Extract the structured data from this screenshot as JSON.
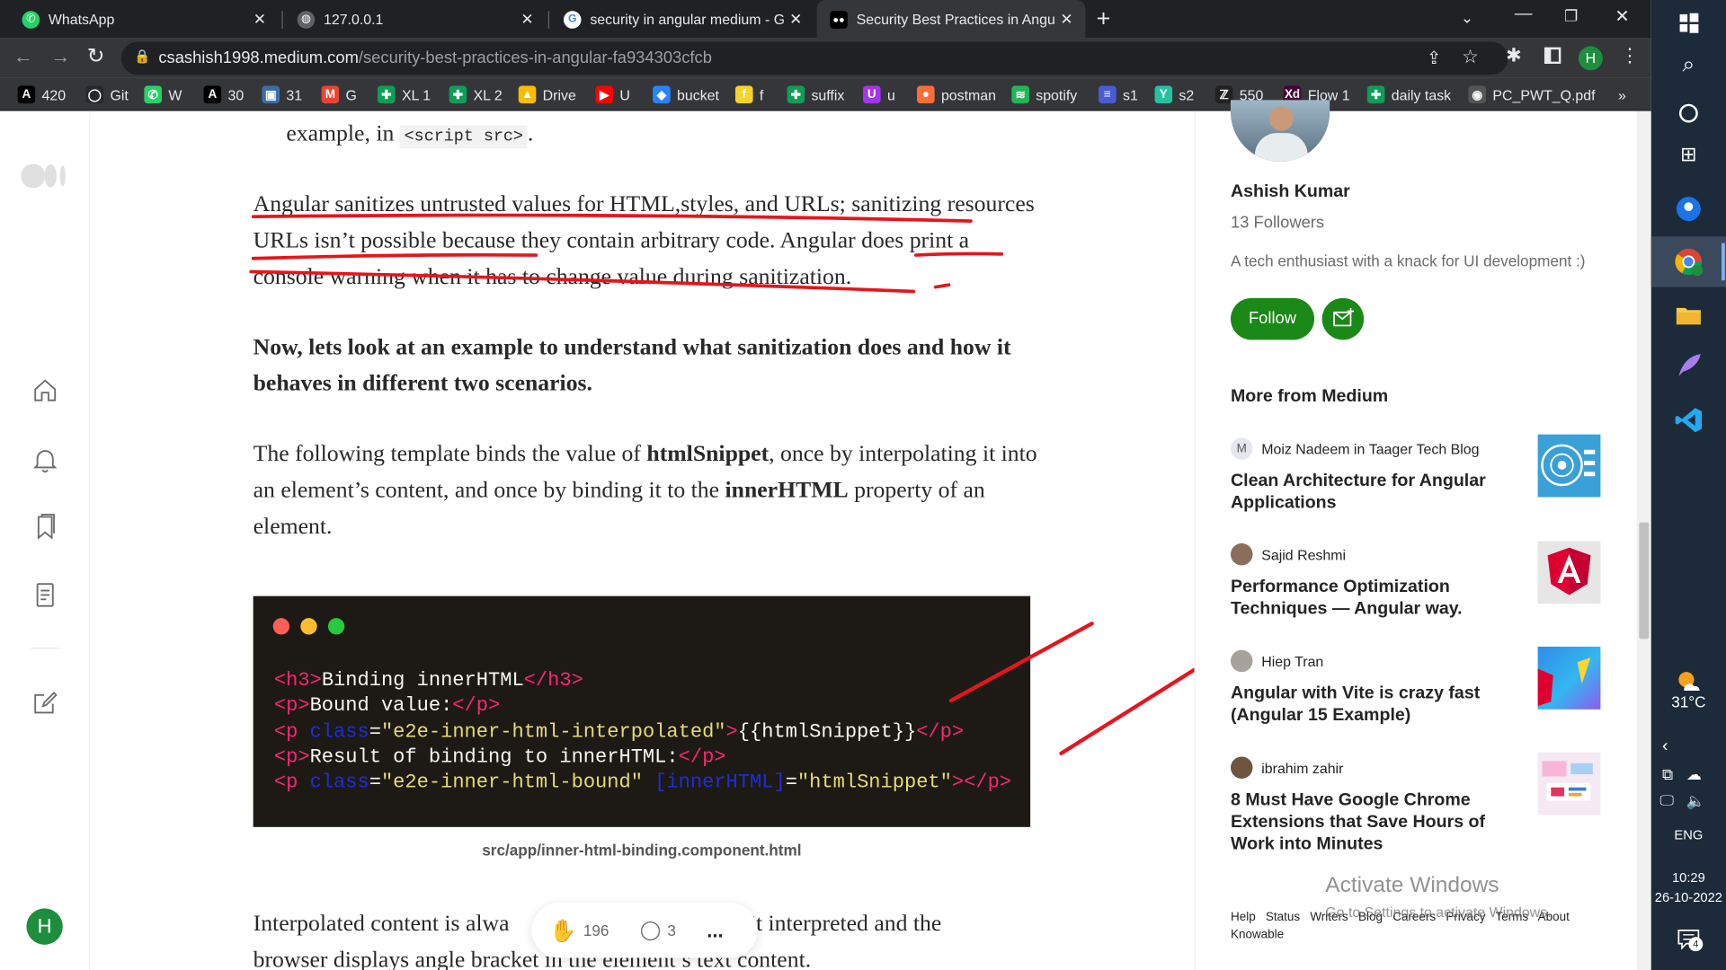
{
  "browser": {
    "tabs": [
      {
        "title": "WhatsApp",
        "icon": "whatsapp-icon"
      },
      {
        "title": "127.0.0.1",
        "icon": "globe-icon"
      },
      {
        "title": "security in angular medium - Goo",
        "icon": "google-icon"
      },
      {
        "title": "Security Best Practices in Angular",
        "icon": "medium-icon"
      }
    ],
    "url_host": "csashish1998.medium.com",
    "url_path": "/security-best-practices-in-angular-fa934303cfcb",
    "profile_initial": "H",
    "bookmarks": [
      {
        "label": "420",
        "icon": "a-icon",
        "color": "#000000",
        "glyph": "A"
      },
      {
        "label": "Git",
        "icon": "github-icon",
        "color": "#24292e",
        "glyph": "◯"
      },
      {
        "label": "W",
        "icon": "whatsapp-icon",
        "color": "#25d366",
        "glyph": "✆"
      },
      {
        "label": "30",
        "icon": "a-icon",
        "color": "#000000",
        "glyph": "A"
      },
      {
        "label": "31",
        "icon": "site-icon",
        "color": "#3b6ea8",
        "glyph": "▣"
      },
      {
        "label": "G",
        "icon": "gmail-icon",
        "color": "#ea4335",
        "glyph": "M"
      },
      {
        "label": "XL 1",
        "icon": "sheets-icon",
        "color": "#0f9d58",
        "glyph": "✚"
      },
      {
        "label": "XL 2",
        "icon": "sheets-icon",
        "color": "#0f9d58",
        "glyph": "✚"
      },
      {
        "label": "Drive",
        "icon": "drive-icon",
        "color": "#fbbc04",
        "glyph": "▲"
      },
      {
        "label": "U",
        "icon": "youtube-icon",
        "color": "#ff0000",
        "glyph": "▶"
      },
      {
        "label": "bucket",
        "icon": "bucket-icon",
        "color": "#2684ff",
        "glyph": "◆"
      },
      {
        "label": "f",
        "icon": "flipkart-icon",
        "color": "#f7d22b",
        "glyph": "f"
      },
      {
        "label": "suffix",
        "icon": "sheets-icon",
        "color": "#0f9d58",
        "glyph": "✚"
      },
      {
        "label": "u",
        "icon": "udemy-icon",
        "color": "#a435f0",
        "glyph": "U"
      },
      {
        "label": "postman",
        "icon": "postman-icon",
        "color": "#ff6c37",
        "glyph": "●"
      },
      {
        "label": "spotify",
        "icon": "spotify-icon",
        "color": "#1db954",
        "glyph": "≋"
      },
      {
        "label": "s1",
        "icon": "site-icon",
        "color": "#4a5bd4",
        "glyph": "≡"
      },
      {
        "label": "s2",
        "icon": "site-icon",
        "color": "#25c2a0",
        "glyph": "Y"
      },
      {
        "label": "550",
        "icon": "site-icon",
        "color": "#222222",
        "glyph": "ℤ"
      },
      {
        "label": "Flow 1",
        "icon": "xd-icon",
        "color": "#470137",
        "glyph": "Xd"
      },
      {
        "label": "daily task",
        "icon": "sheets-icon",
        "color": "#0f9d58",
        "glyph": "✚"
      },
      {
        "label": "PC_PWT_Q.pdf",
        "icon": "chrome-icon",
        "color": "#555555",
        "glyph": "◉"
      }
    ]
  },
  "article": {
    "top_fragment_prefix": "example, in ",
    "top_fragment_code": "<script src>",
    "top_fragment_suffix": ".",
    "para1": "Angular sanitizes untrusted values for HTML,styles, and URLs; sanitizing resources URLs isn’t possible because they contain arbitrary code. Angular does print a console warning when it has to change value during sanitization.",
    "para2": "Now, lets look at an example to understand what sanitization does and how it behaves in different two scenarios.",
    "para3_a": "The following template binds the value of ",
    "para3_b": "htmlSnippet",
    "para3_c": ", once by interpolating it into an element’s content, and once by binding it to the ",
    "para3_d": "innerHTML",
    "para3_e": " property of an element.",
    "code_lines": [
      [
        {
          "t": "<h3>",
          "c": "#f92672"
        },
        {
          "t": "Binding innerHTML",
          "c": "#f8f8f2"
        },
        {
          "t": "</h3>",
          "c": "#f92672"
        }
      ],
      [
        {
          "t": "<p>",
          "c": "#f92672"
        },
        {
          "t": "Bound value:",
          "c": "#f8f8f2"
        },
        {
          "t": "</p>",
          "c": "#f92672"
        }
      ],
      [
        {
          "t": "<p ",
          "c": "#f92672"
        },
        {
          "t": "class",
          "c": "#1e2ed6"
        },
        {
          "t": "=",
          "c": "#f8f8f2"
        },
        {
          "t": "\"e2e-inner-html-interpolated\"",
          "c": "#e6db74"
        },
        {
          "t": ">",
          "c": "#f92672"
        },
        {
          "t": "{{htmlSnippet}}",
          "c": "#f8f8f2"
        },
        {
          "t": "</p>",
          "c": "#f92672"
        }
      ],
      [
        {
          "t": "<p>",
          "c": "#f92672"
        },
        {
          "t": "Result of binding to innerHTML:",
          "c": "#f8f8f2"
        },
        {
          "t": "</p>",
          "c": "#f92672"
        }
      ],
      [
        {
          "t": "<p ",
          "c": "#f92672"
        },
        {
          "t": "class",
          "c": "#1e2ed6"
        },
        {
          "t": "=",
          "c": "#f8f8f2"
        },
        {
          "t": "\"e2e-inner-html-bound\" ",
          "c": "#e6db74"
        },
        {
          "t": "[innerHTML]",
          "c": "#1e2ed6"
        },
        {
          "t": "=",
          "c": "#f8f8f2"
        },
        {
          "t": "\"htmlSnippet\"",
          "c": "#e6db74"
        },
        {
          "t": "></p>",
          "c": "#f92672"
        }
      ]
    ],
    "caption": "src/app/inner-html-binding.component.html",
    "bottom_line1_a": "Interpolated content is alwa",
    "bottom_line1_b": "n’t interpreted and the",
    "bottom_line2": "browser displays angle bracket in the element’s text content.",
    "claps": "196",
    "responses": "3",
    "more": "..."
  },
  "author": {
    "name": "Ashish Kumar",
    "followers": "13 Followers",
    "bio": "A tech enthusiast with a knack for UI development :)",
    "follow_label": "Follow"
  },
  "more_from_medium": {
    "heading": "More from Medium",
    "items": [
      {
        "author": "Moiz Nadeem",
        "in": "in",
        "pub": "Taager Tech Blog",
        "title": "Clean Architecture for Angular Applications",
        "avatar": "M"
      },
      {
        "author": "Sajid Reshmi",
        "in": "",
        "pub": "",
        "title": "Performance Optimization Techniques — Angular way.",
        "avatar": ""
      },
      {
        "author": "Hiep Tran",
        "in": "",
        "pub": "",
        "title": "Angular with Vite is crazy fast (Angular 15 Example)",
        "avatar": ""
      },
      {
        "author": "ibrahim zahir",
        "in": "",
        "pub": "",
        "title": "8 Must Have Google Chrome Extensions that Save Hours of Work into Minutes",
        "avatar": ""
      }
    ]
  },
  "footer_links": [
    "Help",
    "Status",
    "Writers",
    "Blog",
    "Careers",
    "Privacy",
    "Terms",
    "About",
    "Knowable"
  ],
  "watermark": {
    "title": "Activate Windows",
    "sub": "Go to Settings to activate Windows."
  },
  "taskbar": {
    "temperature": "31°C",
    "lang": "ENG",
    "time": "10:29",
    "date": "26-10-2022",
    "notifications": "4"
  },
  "colors": {
    "medium_green": "#1a8917",
    "annotation_red": "#e8141b",
    "code_bg": "#1d1a16"
  }
}
